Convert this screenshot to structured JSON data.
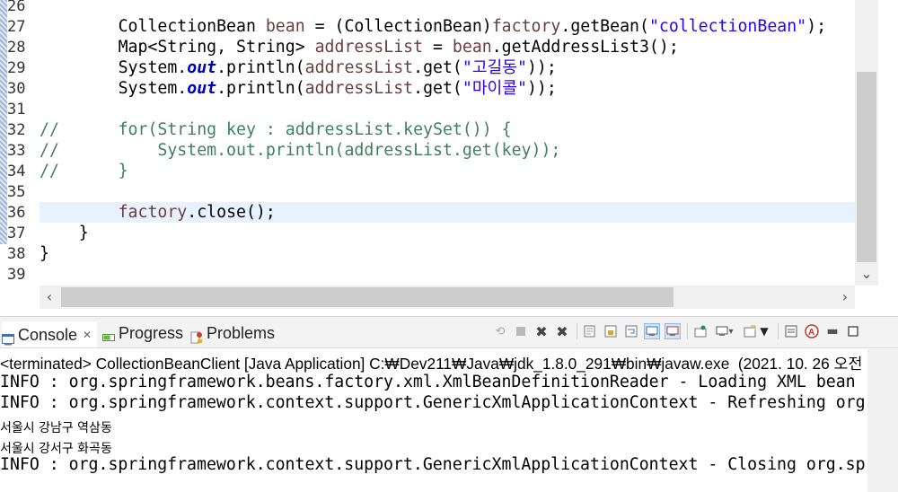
{
  "editor": {
    "lines": [
      {
        "num": "26",
        "tokens": []
      },
      {
        "num": "27",
        "tokens": [
          [
            "",
            "        CollectionBean "
          ],
          [
            "v",
            "bean"
          ],
          [
            "",
            " = (CollectionBean)"
          ],
          [
            "v",
            "factory"
          ],
          [
            "",
            ".getBean("
          ],
          [
            "s",
            "\"collectionBean\""
          ],
          [
            "",
            ");"
          ]
        ]
      },
      {
        "num": "28",
        "tokens": [
          [
            "",
            "        Map<String, String> "
          ],
          [
            "v",
            "addressList"
          ],
          [
            "",
            " = "
          ],
          [
            "v",
            "bean"
          ],
          [
            "",
            ".getAddressList3();"
          ]
        ]
      },
      {
        "num": "29",
        "tokens": [
          [
            "",
            "        System."
          ],
          [
            "f",
            "out"
          ],
          [
            "",
            ".println("
          ],
          [
            "v",
            "addressList"
          ],
          [
            "",
            ".get("
          ],
          [
            "s",
            "\"고길동\""
          ],
          [
            "",
            "));"
          ]
        ]
      },
      {
        "num": "30",
        "tokens": [
          [
            "",
            "        System."
          ],
          [
            "f",
            "out"
          ],
          [
            "",
            ".println("
          ],
          [
            "v",
            "addressList"
          ],
          [
            "",
            ".get("
          ],
          [
            "s",
            "\"마이콜\""
          ],
          [
            "",
            "));"
          ]
        ]
      },
      {
        "num": "31",
        "tokens": []
      },
      {
        "num": "32",
        "tokens": [
          [
            "c",
            "//      for(String key : addressList.keySet()) {"
          ]
        ]
      },
      {
        "num": "33",
        "tokens": [
          [
            "c",
            "//          System.out.println(addressList.get(key));"
          ]
        ]
      },
      {
        "num": "34",
        "tokens": [
          [
            "c",
            "//      }"
          ]
        ]
      },
      {
        "num": "35",
        "tokens": []
      },
      {
        "num": "36",
        "tokens": [
          [
            "",
            "        "
          ],
          [
            "v",
            "factory"
          ],
          [
            "",
            ".close();"
          ]
        ],
        "current": true
      },
      {
        "num": "37",
        "tokens": [
          [
            "",
            "    }"
          ]
        ]
      },
      {
        "num": "38",
        "tokens": [
          [
            "",
            "}"
          ]
        ]
      },
      {
        "num": "39",
        "tokens": []
      }
    ]
  },
  "view": {
    "tabs": {
      "console": "Console",
      "console_close": "✕",
      "progress": "Progress",
      "problems": "Problems"
    },
    "toolbar_icons": [
      "remove-launch-icon",
      "terminate-icon",
      "remove-all-terminated-icon",
      "remove-terminated-icon",
      "clear-console-icon",
      "scroll-lock-icon",
      "word-wrap-icon",
      "show-on-stdout-icon",
      "show-on-stderr-icon",
      "pin-console-icon",
      "display-selected-console-icon",
      "open-console-icon",
      "minimize-icon",
      "maximize-icon"
    ],
    "console": {
      "terminated": "<terminated> CollectionBeanClient [Java Application] C:₩Dev211₩Java₩jdk_1.8.0_291₩bin₩javaw.exe  (2021. 10. 26 오전 1",
      "info1": "INFO : org.springframework.beans.factory.xml.XmlBeanDefinitionReader - Loading XML bean",
      "info2": "INFO : org.springframework.context.support.GenericXmlApplicationContext - Refreshing org",
      "out1": "서울시 강남구 역삼동",
      "out2": "서울시 강서구 화곡동",
      "info3": "INFO : org.springframework.context.support.GenericXmlApplicationContext - Closing org.sp"
    }
  },
  "colors": {
    "keyword": "#7f0055",
    "string": "#2a00ff",
    "field": "#0000c0",
    "comment": "#3f7f5f",
    "variable": "#6a3e3e",
    "current_line": "#e8f2fe"
  }
}
